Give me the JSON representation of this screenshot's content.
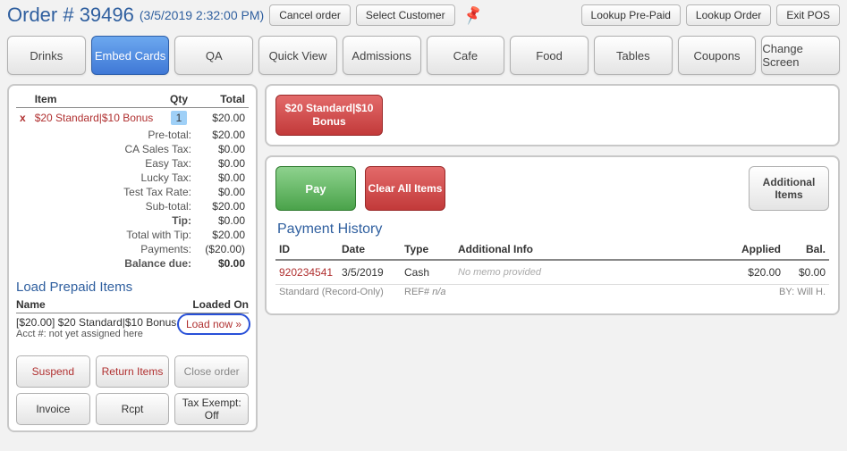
{
  "header": {
    "order_label": "Order # 39496",
    "timestamp": "(3/5/2019 2:32:00 PM)",
    "cancel": "Cancel order",
    "select_customer": "Select Customer",
    "lookup_prepaid": "Lookup Pre-Paid",
    "lookup_order": "Lookup Order",
    "exit_pos": "Exit POS"
  },
  "tabs": [
    "Drinks",
    "Embed Cards",
    "QA",
    "Quick View",
    "Admissions",
    "Cafe",
    "Food",
    "Tables",
    "Coupons",
    "Change Screen"
  ],
  "active_tab_index": 1,
  "items_header": {
    "item": "Item",
    "qty": "Qty",
    "total": "Total"
  },
  "line_item": {
    "name": "$20 Standard|$10 Bonus",
    "qty": "1",
    "total": "$20.00"
  },
  "totals": {
    "pre_total_l": "Pre-total:",
    "pre_total": "$20.00",
    "ca_tax_l": "CA Sales Tax:",
    "ca_tax": "$0.00",
    "easy_tax_l": "Easy Tax:",
    "easy_tax": "$0.00",
    "lucky_tax_l": "Lucky Tax:",
    "lucky_tax": "$0.00",
    "test_tax_l": "Test Tax Rate:",
    "test_tax": "$0.00",
    "sub_total_l": "Sub-total:",
    "sub_total": "$20.00",
    "tip_l": "Tip:",
    "tip": "$0.00",
    "total_tip_l": "Total with Tip:",
    "total_tip": "$20.00",
    "payments_l": "Payments:",
    "payments": "($20.00)",
    "balance_l": "Balance due:",
    "balance": "$0.00"
  },
  "prepaid": {
    "title": "Load Prepaid Items",
    "name_h": "Name",
    "loaded_h": "Loaded On",
    "item_name": "[$20.00] $20 Standard|$10 Bonus",
    "item_sub": "Acct #: not yet assigned here",
    "load_now": "Load now »"
  },
  "actions": {
    "suspend": "Suspend",
    "return": "Return Items",
    "close": "Close order",
    "invoice": "Invoice",
    "rcpt": "Rcpt",
    "tax_exempt": "Tax Exempt: Off"
  },
  "product_chip": "$20 Standard|$10 Bonus",
  "pay": {
    "pay": "Pay",
    "clear": "Clear All Items",
    "additional": "Additional Items"
  },
  "payment_history": {
    "title": "Payment History",
    "cols": {
      "id": "ID",
      "date": "Date",
      "type": "Type",
      "info": "Additional Info",
      "applied": "Applied",
      "bal": "Bal."
    },
    "row": {
      "id": "920234541",
      "date": "3/5/2019",
      "type": "Cash",
      "memo": "No memo provided",
      "applied": "$20.00",
      "bal": "$0.00"
    },
    "sub": {
      "kind": "Standard (Record-Only)",
      "ref_l": "REF#",
      "ref_v": "n/a",
      "by": "BY: Will H."
    }
  }
}
